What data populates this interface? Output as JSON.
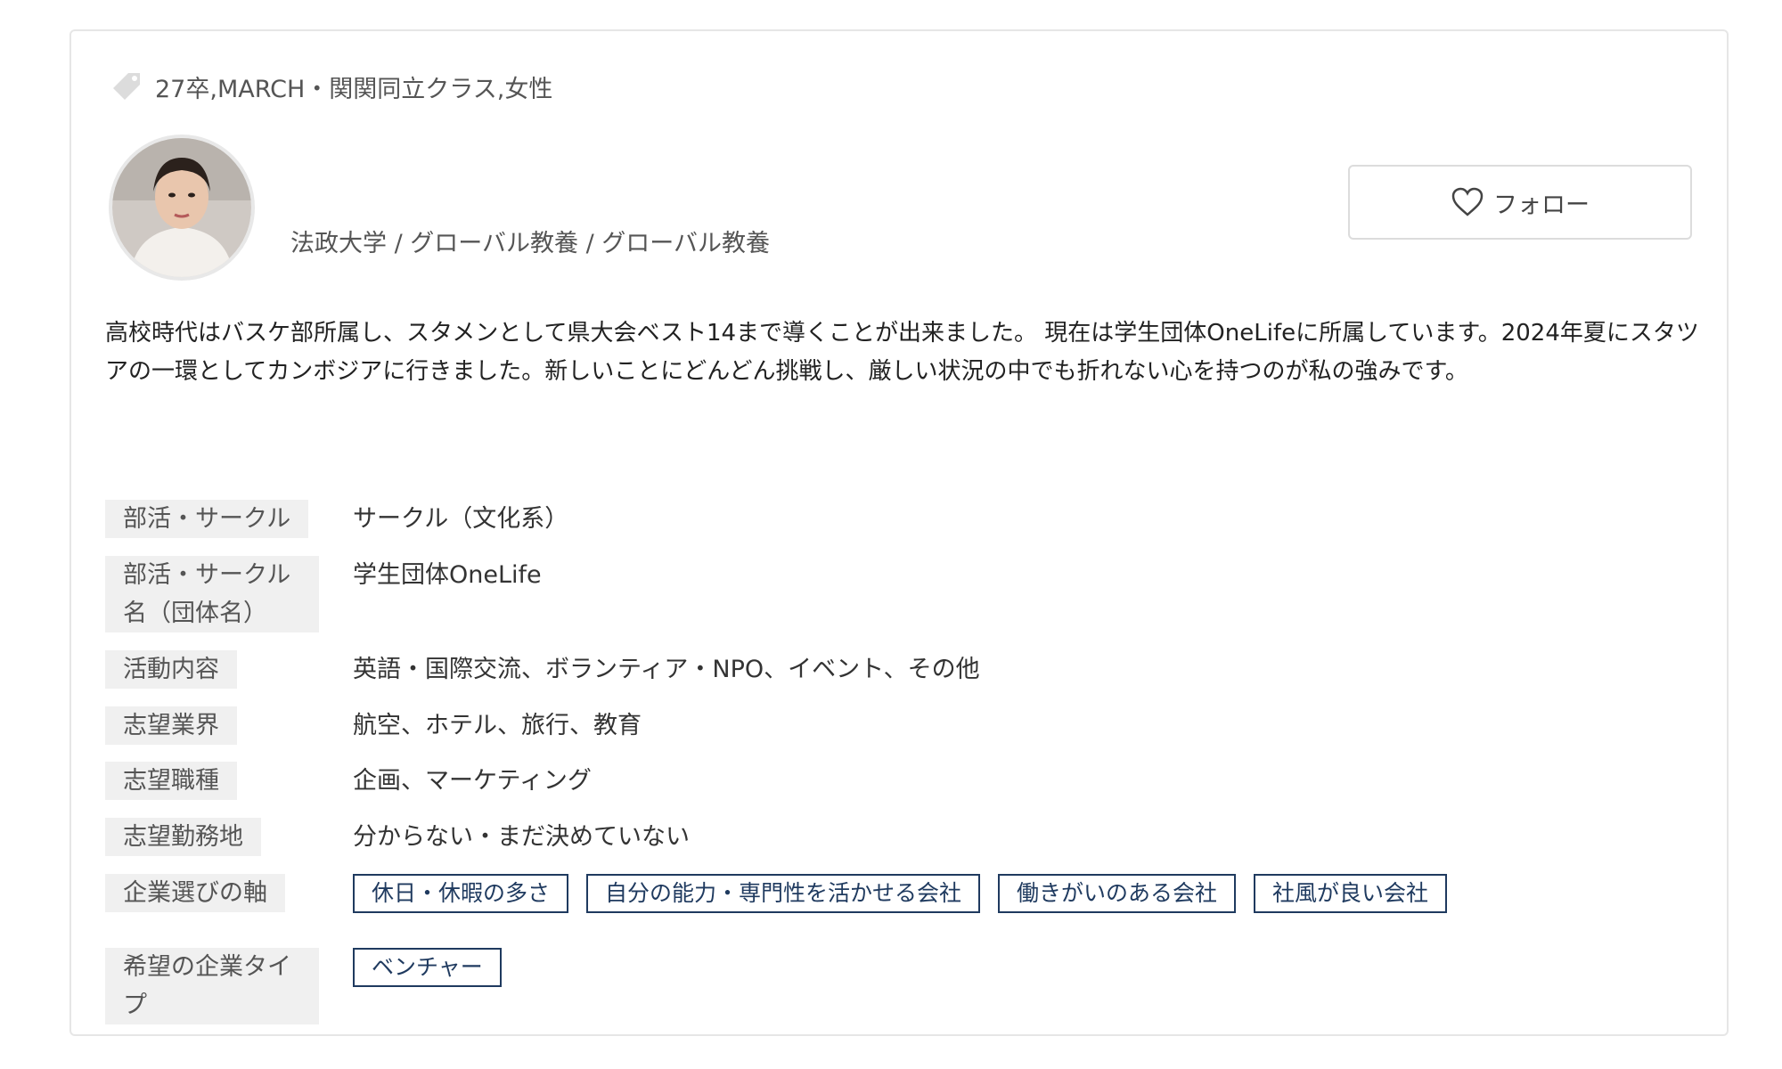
{
  "profile": {
    "tags_text": "27卒,MARCH・関関同立クラス,女性",
    "university": "法政大学 / グローバル教養 / グローバル教養",
    "follow_label": "フォロー",
    "intro": "高校時代はバスケ部所属し、スタメンとして県大会ベスト14まで導くことが出来ました。 現在は学生団体OneLifeに所属しています。2024年夏にスタツアの一環としてカンボジアに行きました。新しいことにどんどん挑戦し、厳しい状況の中でも折れない心を持つのが私の強みです。"
  },
  "details": {
    "club_label": "部活・サークル",
    "club_value": "サークル（文化系）",
    "club_name_label_1": "部活・サークル",
    "club_name_label_2": "名（団体名）",
    "club_name_value": "学生団体OneLife",
    "activity_label": "活動内容",
    "activity_value": "英語・国際交流、ボランティア・NPO、イベント、その他",
    "industry_label": "志望業界",
    "industry_value": "航空、ホテル、旅行、教育",
    "job_label": "志望職種",
    "job_value": "企画、マーケティング",
    "location_label": "志望勤務地",
    "location_value": "分からない・まだ決めていない",
    "axis_label": "企業選びの軸",
    "axis_chips": [
      "休日・休暇の多さ",
      "自分の能力・専門性を活かせる会社",
      "働きがいのある会社",
      "社風が良い会社"
    ],
    "type_label_1": "希望の企業タイ",
    "type_label_2": "プ",
    "type_chips": [
      "ベンチャー"
    ]
  },
  "icons": {
    "tag": "tag-icon",
    "follow": "heart-icon",
    "avatar": "avatar"
  },
  "colors": {
    "chip_border": "#1f3a5f",
    "label_bg": "#f0f0f0",
    "card_border": "#e6e6e6"
  }
}
